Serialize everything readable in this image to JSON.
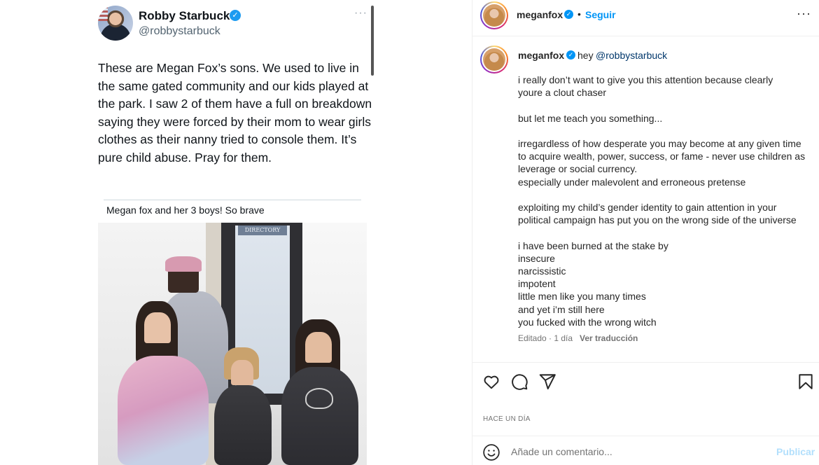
{
  "tweet": {
    "name": "Robby Starbuck",
    "handle": "@robbystarbuck",
    "more": "···",
    "body": "These are Megan Fox’s sons. We used to live in the same gated community and our kids played at the park. I saw 2 of them have a full on breakdown saying they were forced by their mom to wear girls clothes as their nanny tried to console them. It’s pure child abuse. Pray for them.",
    "quote_caption": "Megan fox and her 3 boys! So brave",
    "photo_sign": "DIRECTORY"
  },
  "post": {
    "username": "meganfox",
    "follow_label": "Seguir",
    "more": "···",
    "verified_icon": "verified-badge-icon",
    "caption": {
      "username": "meganfox",
      "hey": "hey",
      "mention": "@robbystarbuck",
      "text": "i really don’t want to give you this attention because clearly\nyoure a clout chaser\n\nbut let me teach you something...\n\nirregardless of how desperate you may become at any given time\nto acquire wealth, power, success, or fame - never use children as\nleverage or social currency.\nespecially under malevolent and erroneous pretense\n\nexploiting my child’s gender identity to gain attention in your\npolitical campaign has put you on the wrong side of the universe\n\ni have been burned at the stake by\ninsecure\nnarcissistic\nimpotent\nlittle men like you many times\nand yet i’m still here\nyou fucked with the wrong witch",
      "meta": "Editado · 1 día",
      "translate": "Ver traducción"
    },
    "actions": {
      "like_icon": "heart-icon",
      "comment_icon": "comment-icon",
      "share_icon": "share-icon",
      "save_icon": "bookmark-icon"
    },
    "time_ago": "HACE UN DÍA",
    "comment": {
      "placeholder": "Añade un comentario...",
      "post_label": "Publicar"
    }
  },
  "colors": {
    "link": "#0095f6",
    "mention": "#00376b",
    "muted": "#737373",
    "text": "#262626"
  }
}
